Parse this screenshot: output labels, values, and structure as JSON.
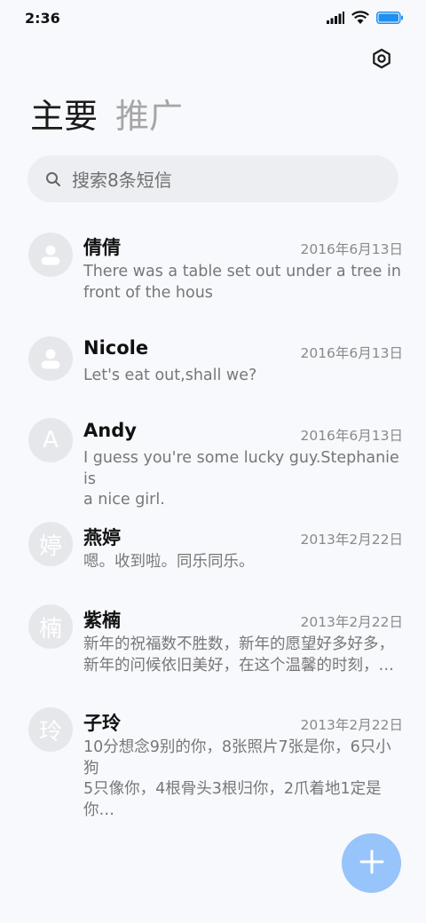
{
  "status_bar": {
    "time": "2:36",
    "icons": [
      "signal-icon",
      "wifi-icon",
      "battery-icon"
    ]
  },
  "header": {
    "settings_icon": "settings-icon"
  },
  "tabs": [
    {
      "label": "主要",
      "active": true
    },
    {
      "label": "推广",
      "active": false
    }
  ],
  "search": {
    "placeholder": "搜索8条短信"
  },
  "conversations": [
    {
      "name": "倩倩",
      "date": "2016年6月13日",
      "avatar": "",
      "preview": [
        "There was a table set out under a tree in",
        "front of the hous"
      ]
    },
    {
      "name": "Nicole",
      "date": "2016年6月13日",
      "avatar": "",
      "preview": [
        "Let's eat out,shall we?"
      ]
    },
    {
      "name": "Andy",
      "date": "2016年6月13日",
      "avatar": "A",
      "preview": [
        "I guess you're some lucky guy.Stephanie is",
        "a nice girl."
      ]
    },
    {
      "name": "燕婷",
      "date": "2013年2月22日",
      "avatar": "婷",
      "preview": [
        "嗯。收到啦。同乐同乐。"
      ]
    },
    {
      "name": "紫楠",
      "date": "2013年2月22日",
      "avatar": "楠",
      "preview": [
        "新年的祝福数不胜数，新年的愿望好多好多，",
        "新年的问候依旧美好，在这个温馨的时刻，…"
      ]
    },
    {
      "name": "子玲",
      "date": "2013年2月22日",
      "avatar": "玲",
      "preview": [
        "10分想念9别的你，8张照片7张是你，6只小狗",
        "5只像你，4根骨头3根归你，2爪着地1定是你…"
      ]
    }
  ],
  "colors": {
    "accent": "#97c4fb",
    "avatar_bg": "#e6e7ea",
    "background": "#f8f9fc"
  },
  "fab": {
    "icon": "plus-icon"
  }
}
